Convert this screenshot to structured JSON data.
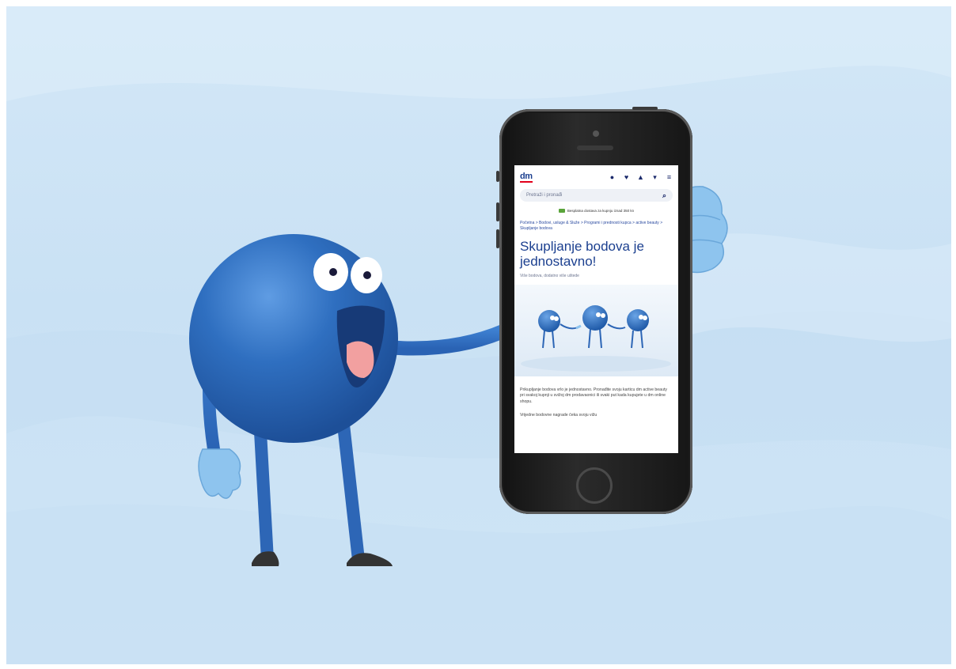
{
  "phone": {
    "logo": "dm",
    "search_placeholder": "Pretraži i pronađi",
    "promo": "Besplatna dostava za kupnju iznad 350 kn",
    "breadcrumb": "Početna > Bodovi, usluge & Služe > Programi i prednosti kupca > active beauty > Skupljanje bodova",
    "title": "Skupljanje bodova je jednostavno!",
    "subtitle": "Više bodova, dodatno više uštede",
    "paragraph1": "Prikupljanje bodova vrlo je jednostavno. Pronađite svoju karticu dm active beauty pri svakoj kupnji u svižoj dm prodavaonici ili svaki put kada kupujete u dm online shopu.",
    "paragraph2": "Vrijedne bodovne nagrade čeka svoju vižu"
  },
  "colors": {
    "mascot_blue": "#2f6fc0",
    "brand_blue": "#1b3f8f",
    "background": "#cfe5f6"
  }
}
